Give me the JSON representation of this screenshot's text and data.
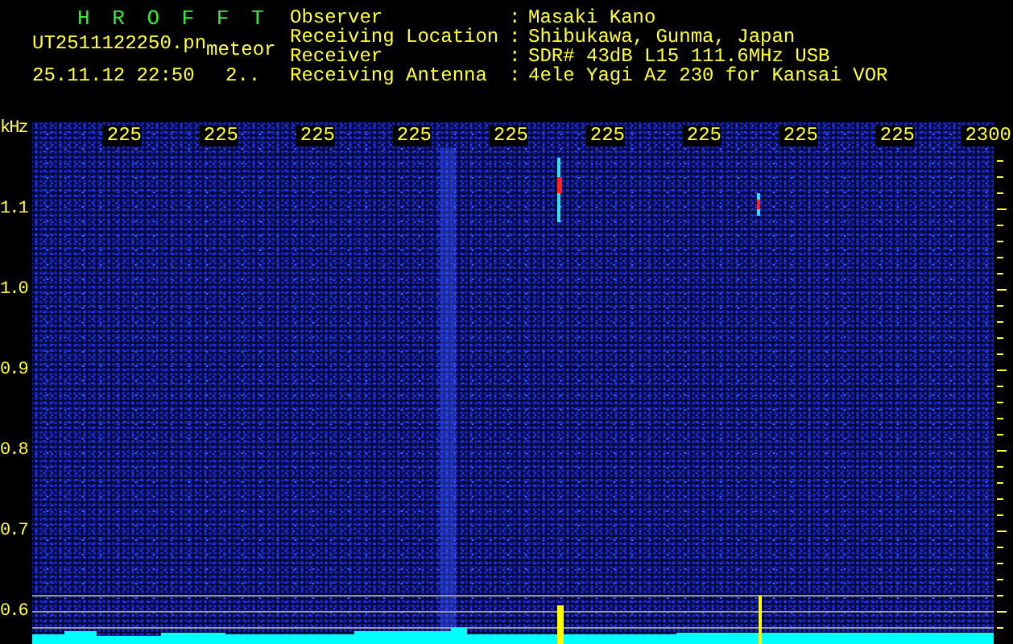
{
  "app_title": "H R O F F T",
  "file": {
    "name": "UT2511122250.pn",
    "mode": "meteor",
    "timestamp": "25.11.12 22:50",
    "count": "2.."
  },
  "station": [
    {
      "label": "Observer",
      "value": "Masaki Kano"
    },
    {
      "label": "Receiving Location",
      "value": "Shibukawa, Gunma, Japan"
    },
    {
      "label": "Receiver",
      "value": "SDR# 43dB L15 111.6MHz USB"
    },
    {
      "label": "Receiving Antenna",
      "value": "4ele Yagi Az 230 for Kansai VOR"
    }
  ],
  "separator": ":",
  "y_unit": "kHz",
  "time_labels": [
    "225",
    "225",
    "225",
    "225",
    "225",
    "225",
    "225",
    "225",
    "225",
    "2300"
  ],
  "freq_labels": [
    "1.1",
    "1.0",
    "0.9",
    "0.8",
    "0.7",
    "0.6"
  ]
}
